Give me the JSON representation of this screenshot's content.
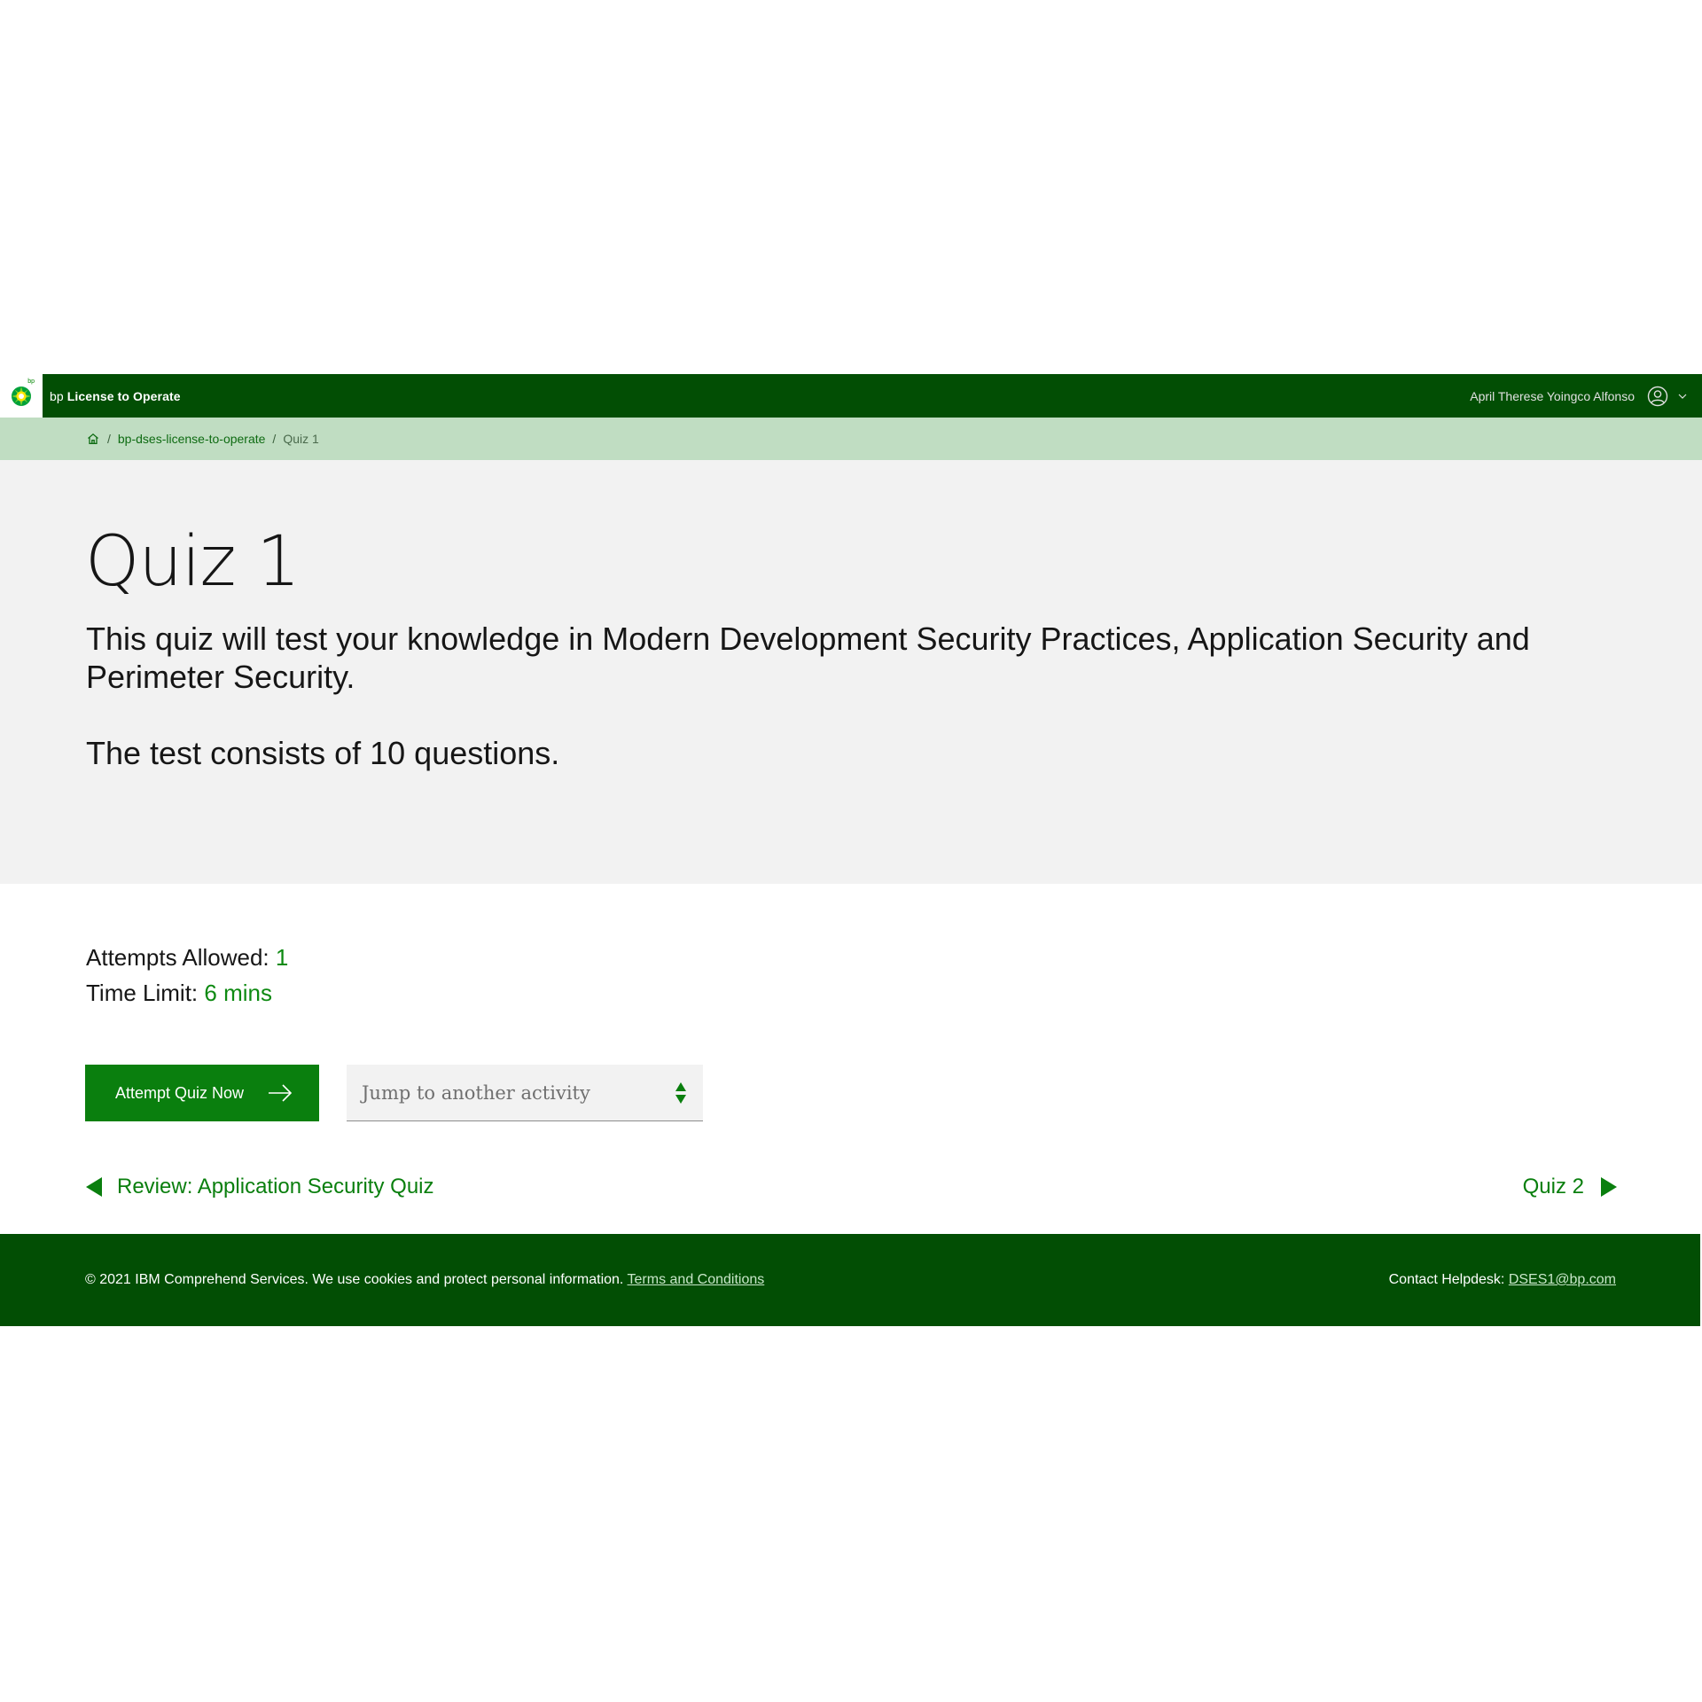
{
  "header": {
    "logo_text": "bp",
    "brand": "bp",
    "app_name": "License to Operate",
    "user_name": "April Therese Yoingco Alfonso",
    "colors": {
      "header_bg": "#024e04",
      "breadcrumb_bg": "#c0ddc2",
      "accent": "#0a7f0e"
    }
  },
  "breadcrumb": {
    "home_icon": "home-icon",
    "items": [
      {
        "label": "bp-dses-license-to-operate"
      },
      {
        "label": "Quiz 1"
      }
    ]
  },
  "hero": {
    "title": "Quiz 1",
    "description": "This quiz will test your knowledge in Modern Development Security Practices, Application Security and Perimeter Security.",
    "question_count_text": "The test consists of 10 questions."
  },
  "info": {
    "attempts_label": "Attempts Allowed:",
    "attempts_value": "1",
    "time_label": "Time Limit:",
    "time_value": "6 mins"
  },
  "actions": {
    "attempt_label": "Attempt Quiz Now",
    "jump_placeholder": "Jump to another activity"
  },
  "navigation": {
    "prev_label": "Review: Application Security Quiz",
    "next_label": "Quiz 2"
  },
  "footer": {
    "copyright": "© 2021 IBM Comprehend Services. We use cookies and protect personal information.",
    "terms_label": "Terms and Conditions",
    "helpdesk_label": "Contact Helpdesk:",
    "helpdesk_email": "DSES1@bp.com"
  }
}
